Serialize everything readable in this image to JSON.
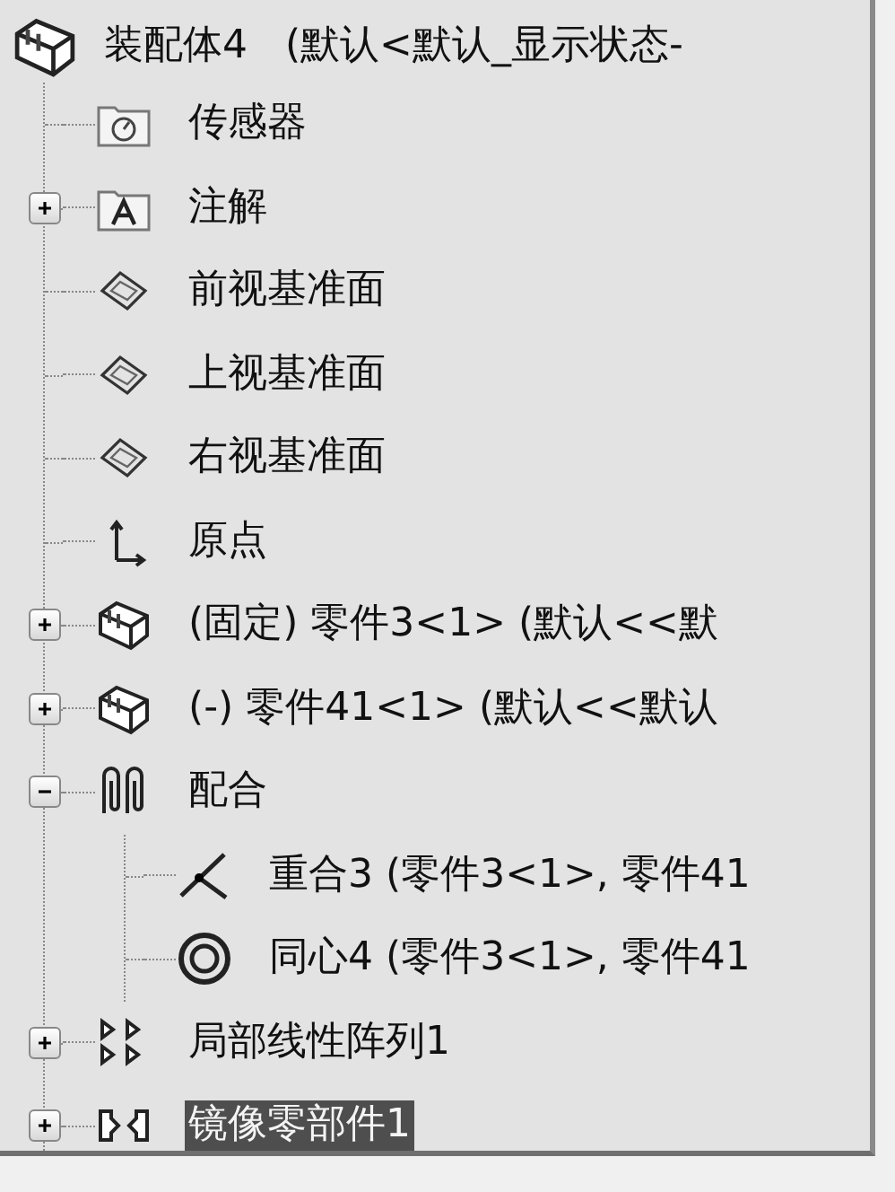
{
  "tree": {
    "label": "装配体4   (默认<默认_显示状态-",
    "kind": "assembly",
    "selected": false,
    "children": [
      {
        "label": "传感器",
        "kind": "sensor-folder",
        "selected": false
      },
      {
        "label": "注解",
        "kind": "annotation-folder",
        "expanded": false,
        "selected": false
      },
      {
        "label": "前视基准面",
        "kind": "plane",
        "selected": false
      },
      {
        "label": "上视基准面",
        "kind": "plane",
        "selected": false
      },
      {
        "label": "右视基准面",
        "kind": "plane",
        "selected": false
      },
      {
        "label": "原点",
        "kind": "origin",
        "selected": false
      },
      {
        "label": "(固定) 零件3<1> (默认<<默",
        "kind": "part",
        "expanded": false,
        "selected": false
      },
      {
        "label": "(-) 零件41<1> (默认<<默认",
        "kind": "part",
        "expanded": false,
        "selected": false
      },
      {
        "label": "配合",
        "kind": "mates",
        "expanded": true,
        "selected": false,
        "children": [
          {
            "label": "重合3 (零件3<1>, 零件41",
            "kind": "coincident",
            "selected": false
          },
          {
            "label": "同心4 (零件3<1>, 零件41",
            "kind": "concentric",
            "selected": false
          }
        ]
      },
      {
        "label": "局部线性阵列1",
        "kind": "pattern",
        "expanded": false,
        "selected": false
      },
      {
        "label": "镜像零部件1",
        "kind": "mirror",
        "expanded": false,
        "selected": true
      }
    ]
  }
}
